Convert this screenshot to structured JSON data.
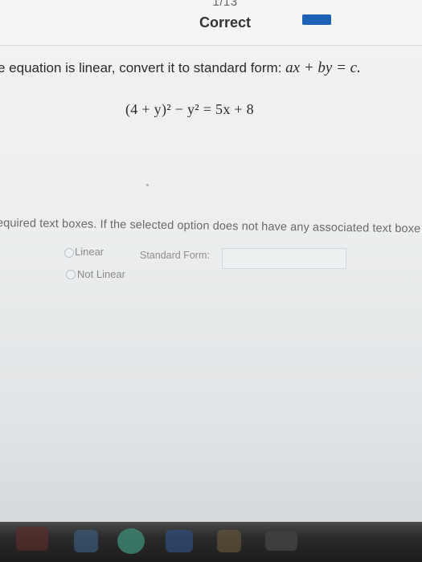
{
  "header": {
    "counter": "1/13",
    "status": "Correct",
    "progress_fraction": 1,
    "accent_color": "#1e62b8"
  },
  "question": {
    "text_prefix": "e equation is linear, convert it to standard form: ",
    "standard_form": "ax + by = c.",
    "equation": "(4 + y)² − y² = 5x + 8"
  },
  "instruction": "equired text boxes. If the selected option does not have any associated text boxe",
  "options": [
    {
      "label": "Linear"
    },
    {
      "label": "Not Linear"
    }
  ],
  "standard_form_field": {
    "label": "Standard Form:",
    "value": ""
  }
}
